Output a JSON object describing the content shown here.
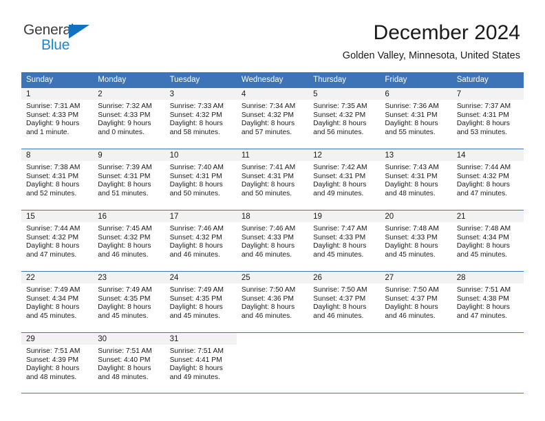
{
  "branding": {
    "name_part1": "General",
    "name_part2": "Blue",
    "triangle_color": "#1072c0",
    "blue_color": "#1c86d4"
  },
  "header": {
    "title": "December 2024",
    "subtitle": "Golden Valley, Minnesota, United States"
  },
  "theme": {
    "header_bar_color": "#3d74b8",
    "day_number_strip_color": "#f2f2f2",
    "grid_line_color": "#3d74b8",
    "text_color": "#1a1a1a"
  },
  "weekday_headers": [
    "Sunday",
    "Monday",
    "Tuesday",
    "Wednesday",
    "Thursday",
    "Friday",
    "Saturday"
  ],
  "weeks": [
    [
      {
        "day": "1",
        "sunrise": "Sunrise: 7:31 AM",
        "sunset": "Sunset: 4:33 PM",
        "daylight_line1": "Daylight: 9 hours",
        "daylight_line2": "and 1 minute."
      },
      {
        "day": "2",
        "sunrise": "Sunrise: 7:32 AM",
        "sunset": "Sunset: 4:33 PM",
        "daylight_line1": "Daylight: 9 hours",
        "daylight_line2": "and 0 minutes."
      },
      {
        "day": "3",
        "sunrise": "Sunrise: 7:33 AM",
        "sunset": "Sunset: 4:32 PM",
        "daylight_line1": "Daylight: 8 hours",
        "daylight_line2": "and 58 minutes."
      },
      {
        "day": "4",
        "sunrise": "Sunrise: 7:34 AM",
        "sunset": "Sunset: 4:32 PM",
        "daylight_line1": "Daylight: 8 hours",
        "daylight_line2": "and 57 minutes."
      },
      {
        "day": "5",
        "sunrise": "Sunrise: 7:35 AM",
        "sunset": "Sunset: 4:32 PM",
        "daylight_line1": "Daylight: 8 hours",
        "daylight_line2": "and 56 minutes."
      },
      {
        "day": "6",
        "sunrise": "Sunrise: 7:36 AM",
        "sunset": "Sunset: 4:31 PM",
        "daylight_line1": "Daylight: 8 hours",
        "daylight_line2": "and 55 minutes."
      },
      {
        "day": "7",
        "sunrise": "Sunrise: 7:37 AM",
        "sunset": "Sunset: 4:31 PM",
        "daylight_line1": "Daylight: 8 hours",
        "daylight_line2": "and 53 minutes."
      }
    ],
    [
      {
        "day": "8",
        "sunrise": "Sunrise: 7:38 AM",
        "sunset": "Sunset: 4:31 PM",
        "daylight_line1": "Daylight: 8 hours",
        "daylight_line2": "and 52 minutes."
      },
      {
        "day": "9",
        "sunrise": "Sunrise: 7:39 AM",
        "sunset": "Sunset: 4:31 PM",
        "daylight_line1": "Daylight: 8 hours",
        "daylight_line2": "and 51 minutes."
      },
      {
        "day": "10",
        "sunrise": "Sunrise: 7:40 AM",
        "sunset": "Sunset: 4:31 PM",
        "daylight_line1": "Daylight: 8 hours",
        "daylight_line2": "and 50 minutes."
      },
      {
        "day": "11",
        "sunrise": "Sunrise: 7:41 AM",
        "sunset": "Sunset: 4:31 PM",
        "daylight_line1": "Daylight: 8 hours",
        "daylight_line2": "and 50 minutes."
      },
      {
        "day": "12",
        "sunrise": "Sunrise: 7:42 AM",
        "sunset": "Sunset: 4:31 PM",
        "daylight_line1": "Daylight: 8 hours",
        "daylight_line2": "and 49 minutes."
      },
      {
        "day": "13",
        "sunrise": "Sunrise: 7:43 AM",
        "sunset": "Sunset: 4:31 PM",
        "daylight_line1": "Daylight: 8 hours",
        "daylight_line2": "and 48 minutes."
      },
      {
        "day": "14",
        "sunrise": "Sunrise: 7:44 AM",
        "sunset": "Sunset: 4:32 PM",
        "daylight_line1": "Daylight: 8 hours",
        "daylight_line2": "and 47 minutes."
      }
    ],
    [
      {
        "day": "15",
        "sunrise": "Sunrise: 7:44 AM",
        "sunset": "Sunset: 4:32 PM",
        "daylight_line1": "Daylight: 8 hours",
        "daylight_line2": "and 47 minutes."
      },
      {
        "day": "16",
        "sunrise": "Sunrise: 7:45 AM",
        "sunset": "Sunset: 4:32 PM",
        "daylight_line1": "Daylight: 8 hours",
        "daylight_line2": "and 46 minutes."
      },
      {
        "day": "17",
        "sunrise": "Sunrise: 7:46 AM",
        "sunset": "Sunset: 4:32 PM",
        "daylight_line1": "Daylight: 8 hours",
        "daylight_line2": "and 46 minutes."
      },
      {
        "day": "18",
        "sunrise": "Sunrise: 7:46 AM",
        "sunset": "Sunset: 4:33 PM",
        "daylight_line1": "Daylight: 8 hours",
        "daylight_line2": "and 46 minutes."
      },
      {
        "day": "19",
        "sunrise": "Sunrise: 7:47 AM",
        "sunset": "Sunset: 4:33 PM",
        "daylight_line1": "Daylight: 8 hours",
        "daylight_line2": "and 45 minutes."
      },
      {
        "day": "20",
        "sunrise": "Sunrise: 7:48 AM",
        "sunset": "Sunset: 4:33 PM",
        "daylight_line1": "Daylight: 8 hours",
        "daylight_line2": "and 45 minutes."
      },
      {
        "day": "21",
        "sunrise": "Sunrise: 7:48 AM",
        "sunset": "Sunset: 4:34 PM",
        "daylight_line1": "Daylight: 8 hours",
        "daylight_line2": "and 45 minutes."
      }
    ],
    [
      {
        "day": "22",
        "sunrise": "Sunrise: 7:49 AM",
        "sunset": "Sunset: 4:34 PM",
        "daylight_line1": "Daylight: 8 hours",
        "daylight_line2": "and 45 minutes."
      },
      {
        "day": "23",
        "sunrise": "Sunrise: 7:49 AM",
        "sunset": "Sunset: 4:35 PM",
        "daylight_line1": "Daylight: 8 hours",
        "daylight_line2": "and 45 minutes."
      },
      {
        "day": "24",
        "sunrise": "Sunrise: 7:49 AM",
        "sunset": "Sunset: 4:35 PM",
        "daylight_line1": "Daylight: 8 hours",
        "daylight_line2": "and 45 minutes."
      },
      {
        "day": "25",
        "sunrise": "Sunrise: 7:50 AM",
        "sunset": "Sunset: 4:36 PM",
        "daylight_line1": "Daylight: 8 hours",
        "daylight_line2": "and 46 minutes."
      },
      {
        "day": "26",
        "sunrise": "Sunrise: 7:50 AM",
        "sunset": "Sunset: 4:37 PM",
        "daylight_line1": "Daylight: 8 hours",
        "daylight_line2": "and 46 minutes."
      },
      {
        "day": "27",
        "sunrise": "Sunrise: 7:50 AM",
        "sunset": "Sunset: 4:37 PM",
        "daylight_line1": "Daylight: 8 hours",
        "daylight_line2": "and 46 minutes."
      },
      {
        "day": "28",
        "sunrise": "Sunrise: 7:51 AM",
        "sunset": "Sunset: 4:38 PM",
        "daylight_line1": "Daylight: 8 hours",
        "daylight_line2": "and 47 minutes."
      }
    ],
    [
      {
        "day": "29",
        "sunrise": "Sunrise: 7:51 AM",
        "sunset": "Sunset: 4:39 PM",
        "daylight_line1": "Daylight: 8 hours",
        "daylight_line2": "and 48 minutes."
      },
      {
        "day": "30",
        "sunrise": "Sunrise: 7:51 AM",
        "sunset": "Sunset: 4:40 PM",
        "daylight_line1": "Daylight: 8 hours",
        "daylight_line2": "and 48 minutes."
      },
      {
        "day": "31",
        "sunrise": "Sunrise: 7:51 AM",
        "sunset": "Sunset: 4:41 PM",
        "daylight_line1": "Daylight: 8 hours",
        "daylight_line2": "and 49 minutes."
      },
      {
        "day": "",
        "sunrise": "",
        "sunset": "",
        "daylight_line1": "",
        "daylight_line2": ""
      },
      {
        "day": "",
        "sunrise": "",
        "sunset": "",
        "daylight_line1": "",
        "daylight_line2": ""
      },
      {
        "day": "",
        "sunrise": "",
        "sunset": "",
        "daylight_line1": "",
        "daylight_line2": ""
      },
      {
        "day": "",
        "sunrise": "",
        "sunset": "",
        "daylight_line1": "",
        "daylight_line2": ""
      }
    ]
  ]
}
